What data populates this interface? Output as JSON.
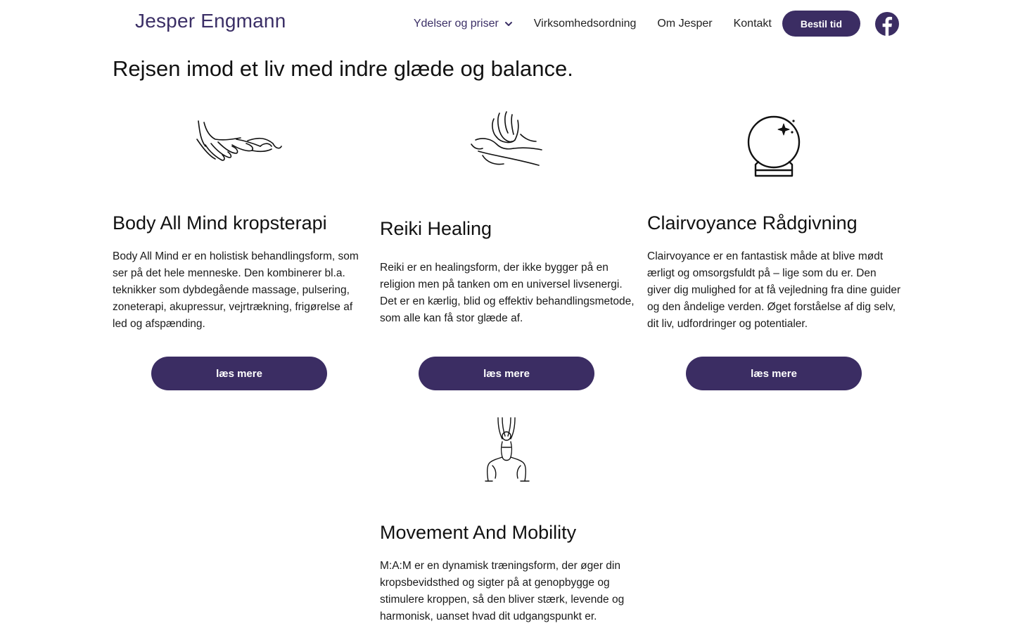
{
  "header": {
    "logo": "Jesper Engmann",
    "nav": [
      {
        "label": "Ydelser og priser",
        "dropdown": true
      },
      {
        "label": "Virksomhedsordning"
      },
      {
        "label": "Om Jesper"
      },
      {
        "label": "Kontakt"
      }
    ],
    "book_label": "Bestil tid",
    "social_icon": "facebook-icon"
  },
  "page_title": "Rejsen imod et liv med indre glæde og balance.",
  "services": [
    {
      "icon": "hands-massage-icon",
      "title": "Body All Mind kropsterapi",
      "text": "Body All Mind er en holistisk behandlingsform, som ser på det hele menneske. Den kombinerer bl.a. teknikker som dybdegående massage, pulsering, zoneterapi, akupressur, vejrtrækning, frigørelse af led og afspænding.",
      "button": "læs mere"
    },
    {
      "icon": "healing-hands-icon",
      "title": "Reiki Healing",
      "text": "Reiki er en healingsform, der ikke bygger på en religion men på tanken om en universel livsenergi. Det er en kærlig, blid og effektiv behandlingsmetode, som alle kan få stor glæde af.",
      "button": "læs mere"
    },
    {
      "icon": "crystal-ball-icon",
      "title": "Clairvoyance Rådgivning",
      "text": "Clairvoyance er en fantastisk måde at blive mødt ærligt og omsorgsfuldt på – lige som du er. Den giver dig mulighed for at få vejledning fra dine guider og den åndelige verden. Øget forståelse af dig selv, dit liv, udfordringer og potentialer.",
      "button": "læs mere"
    },
    {
      "icon": "yoga-pose-icon",
      "title": "Movement And Mobility",
      "text": "M:A:M er en dynamisk træningsform, der øger din kropsbevidsthed og sigter på at genopbygge og stimulere kroppen, så den bliver stærk, levende og harmonisk, uanset hvad dit udgangspunkt er."
    }
  ],
  "colors": {
    "brand": "#3b2d63",
    "logo": "#3b2f66",
    "text": "#111111",
    "background": "#ffffff"
  }
}
